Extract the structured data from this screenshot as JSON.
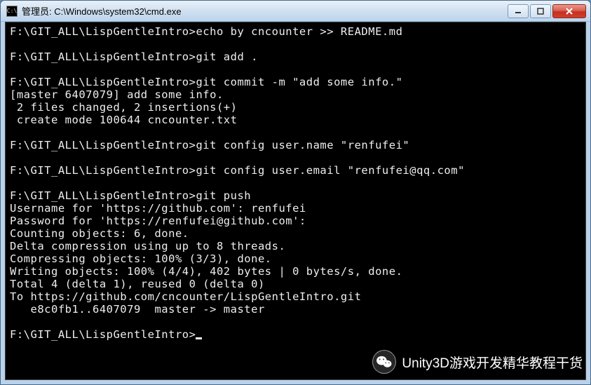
{
  "window": {
    "icon_text": "C:\\",
    "title": "管理员: C:\\Windows\\system32\\cmd.exe"
  },
  "terminal": {
    "lines": [
      "F:\\GIT_ALL\\LispGentleIntro>echo by cncounter >> README.md",
      "",
      "F:\\GIT_ALL\\LispGentleIntro>git add .",
      "",
      "F:\\GIT_ALL\\LispGentleIntro>git commit -m \"add some info.\"",
      "[master 6407079] add some info.",
      " 2 files changed, 2 insertions(+)",
      " create mode 100644 cncounter.txt",
      "",
      "F:\\GIT_ALL\\LispGentleIntro>git config user.name \"renfufei\"",
      "",
      "F:\\GIT_ALL\\LispGentleIntro>git config user.email \"renfufei@qq.com\"",
      "",
      "F:\\GIT_ALL\\LispGentleIntro>git push",
      "Username for 'https://github.com': renfufei",
      "Password for 'https://renfufei@github.com':",
      "Counting objects: 6, done.",
      "Delta compression using up to 8 threads.",
      "Compressing objects: 100% (3/3), done.",
      "Writing objects: 100% (4/4), 402 bytes | 0 bytes/s, done.",
      "Total 4 (delta 1), reused 0 (delta 0)",
      "To https://github.com/cncounter/LispGentleIntro.git",
      "   e8c0fb1..6407079  master -> master",
      "",
      "F:\\GIT_ALL\\LispGentleIntro>"
    ]
  },
  "watermark": {
    "text": "Unity3D游戏开发精华教程干货"
  }
}
